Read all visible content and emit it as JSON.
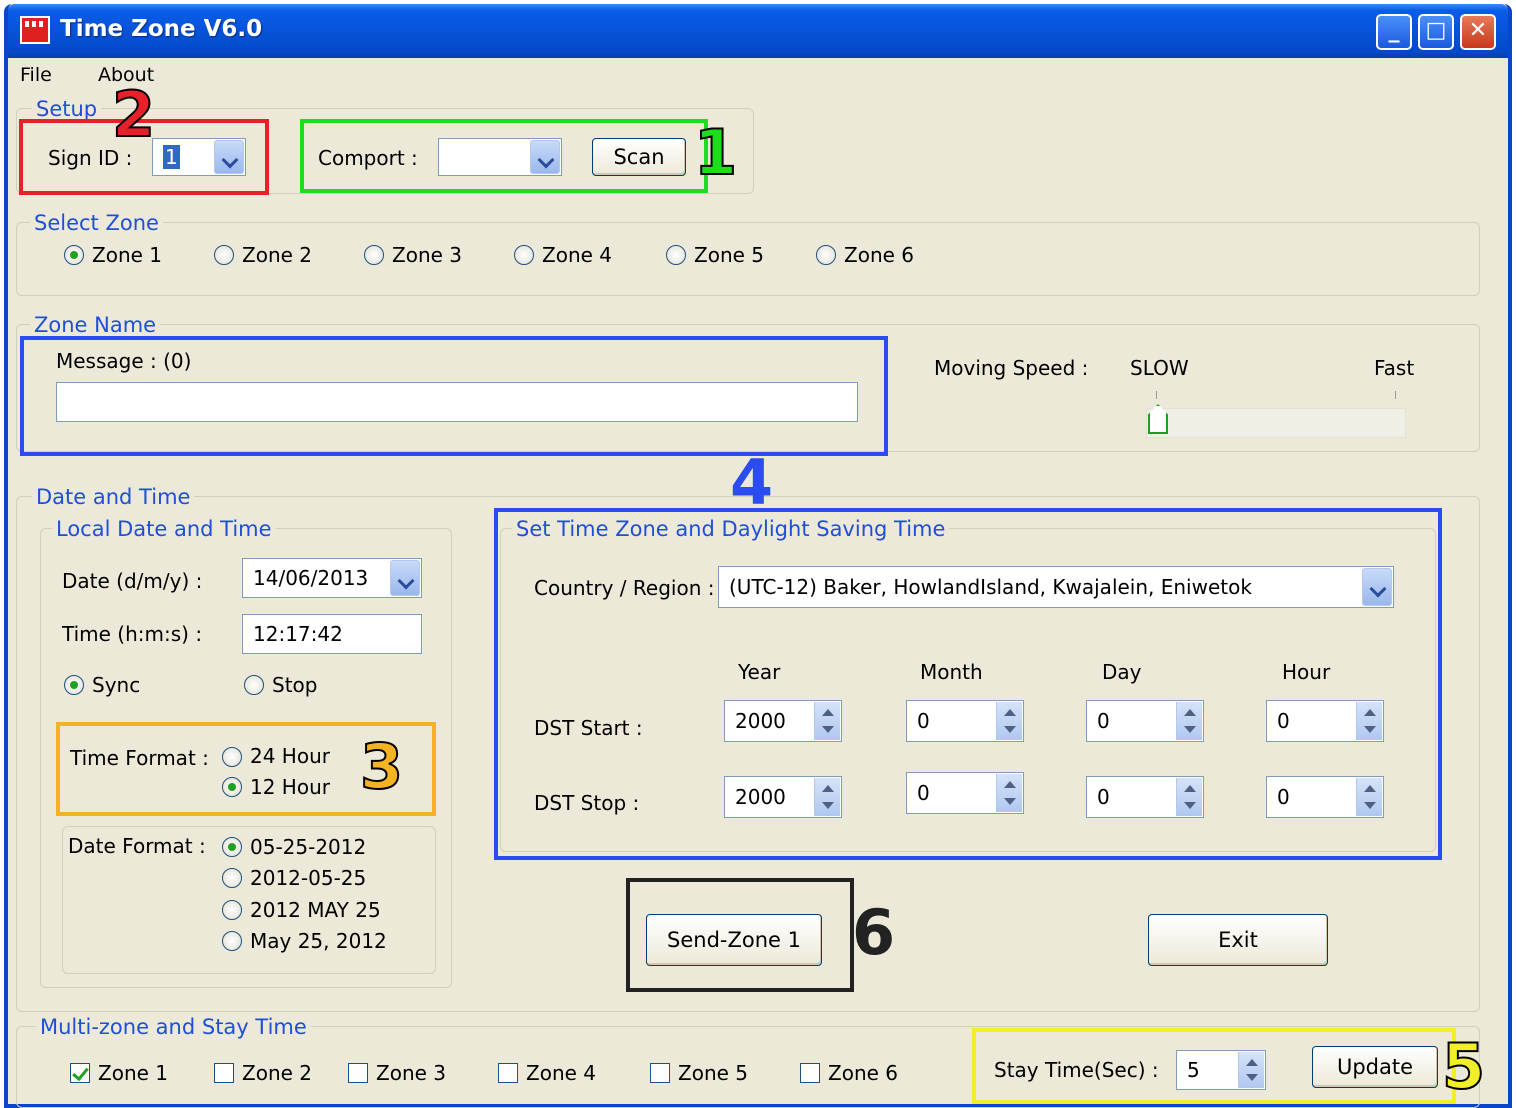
{
  "window": {
    "title": "Time Zone V6.0"
  },
  "menu": {
    "file": "File",
    "about": "About"
  },
  "setup": {
    "title": "Setup",
    "sign_id_label": "Sign ID :",
    "sign_id_value": "1",
    "comport_label": "Comport :",
    "comport_value": "",
    "scan_label": "Scan"
  },
  "select_zone": {
    "title": "Select Zone",
    "zones": [
      "Zone 1",
      "Zone 2",
      "Zone 3",
      "Zone 4",
      "Zone 5",
      "Zone 6"
    ],
    "selected": "Zone 1"
  },
  "zone_name": {
    "title": "Zone Name",
    "message_label": "Message : (0)",
    "message_value": "",
    "speed_label": "Moving Speed :",
    "slow_label": "SLOW",
    "fast_label": "Fast",
    "speed_level": 0
  },
  "date_time": {
    "title": "Date and Time",
    "local_title": "Local Date and Time",
    "date_label": "Date (d/m/y) :",
    "date_value": "14/06/2013",
    "time_label": "Time (h:m:s) :",
    "time_value": "12:17:42",
    "sync_label": "Sync",
    "stop_label": "Stop",
    "sync_selected": "Sync",
    "time_format_label": "Time Format :",
    "time_formats": [
      "24 Hour",
      "12 Hour"
    ],
    "time_format_selected": "12 Hour",
    "date_format_label": "Date Format :",
    "date_formats": [
      "05-25-2012",
      "2012-05-25",
      "2012 MAY 25",
      "May 25, 2012"
    ],
    "date_format_selected": "05-25-2012"
  },
  "dst": {
    "title": "Set Time Zone and Daylight Saving Time",
    "country_label": "Country / Region :",
    "country_value": "(UTC-12)  Baker, HowlandIsland, Kwajalein, Eniwetok",
    "col_year": "Year",
    "col_month": "Month",
    "col_day": "Day",
    "col_hour": "Hour",
    "start_label": "DST Start :",
    "stop_label": "DST Stop :",
    "start": {
      "year": "2000",
      "month": "0",
      "day": "0",
      "hour": "0"
    },
    "stop": {
      "year": "2000",
      "month": "0",
      "day": "0",
      "hour": "0"
    }
  },
  "actions": {
    "send_label": "Send-Zone 1",
    "exit_label": "Exit"
  },
  "multizone": {
    "title": "Multi-zone  and  Stay Time",
    "zones": [
      "Zone 1",
      "Zone 2",
      "Zone 3",
      "Zone 4",
      "Zone 5",
      "Zone 6"
    ],
    "checked": [
      "Zone 1"
    ],
    "stay_label": "Stay Time(Sec) :",
    "stay_value": "5",
    "update_label": "Update"
  },
  "annotations": {
    "n1": "1",
    "n2": "2",
    "n3": "3",
    "n4": "4",
    "n5": "5",
    "n6": "6"
  },
  "colors": {
    "red": "#e8202a",
    "green": "#1edc1e",
    "orange": "#f5b223",
    "blue": "#2a4cf0",
    "black": "#222222",
    "yellow": "#f2ef2a"
  },
  "icons": {
    "app": "app-sign-icon",
    "minimize": "minimize-icon",
    "maximize": "maximize-icon",
    "close": "close-icon",
    "dropdown": "chevron-down-icon",
    "spinner": "spinner-arrows-icon",
    "radio": "radio-icon",
    "checkbox": "checkbox-icon",
    "slider_thumb": "slider-thumb-icon"
  }
}
